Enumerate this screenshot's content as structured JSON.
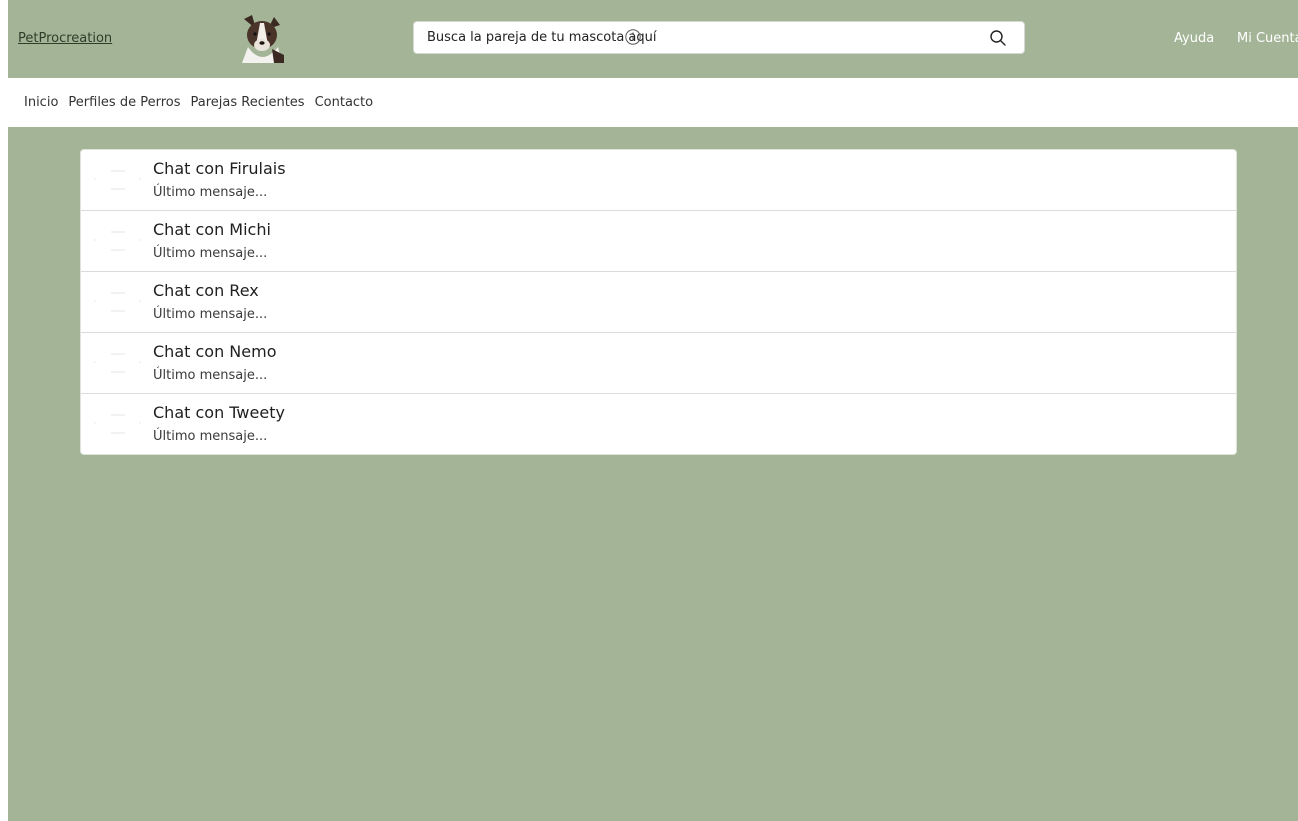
{
  "header": {
    "brand": "PetProcreation",
    "logo_icon": "dog-face-logo",
    "search": {
      "placeholder": "Busca la pareja de tu mascota aquí",
      "value": ""
    },
    "search_icon": "magnifier-icon",
    "info_icon": "info-circle-icon",
    "help_label": "Ayuda",
    "account_label": "Mi Cuenta"
  },
  "nav": {
    "items": [
      "Inicio",
      "Perfiles de Perros",
      "Parejas Recientes",
      "Contacto"
    ]
  },
  "chats": [
    {
      "title": "Chat con Firulais",
      "preview": "Último mensaje..."
    },
    {
      "title": "Chat con Michi",
      "preview": "Último mensaje..."
    },
    {
      "title": "Chat con Rex",
      "preview": "Último mensaje..."
    },
    {
      "title": "Chat con Nemo",
      "preview": "Último mensaje..."
    },
    {
      "title": "Chat con Tweety",
      "preview": "Último mensaje..."
    }
  ],
  "colors": {
    "background": "#a3b596",
    "panel": "#ffffff",
    "header_link": "#ffffff"
  }
}
